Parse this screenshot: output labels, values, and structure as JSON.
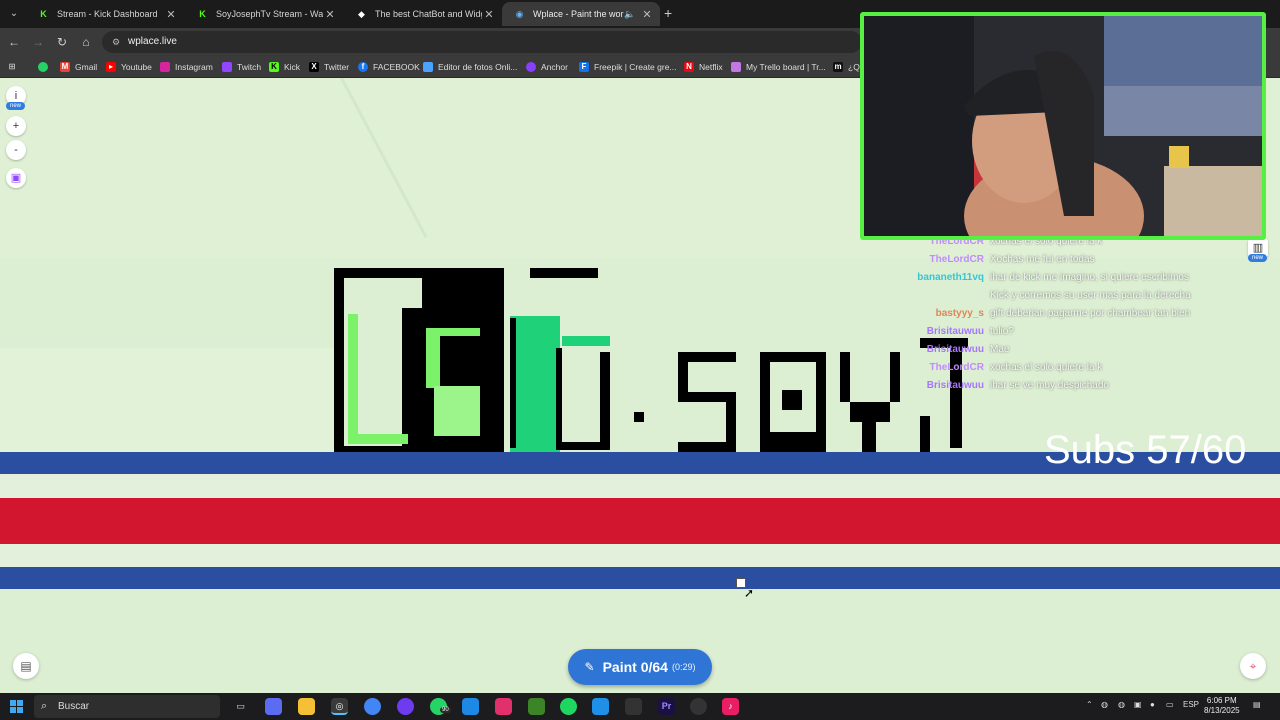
{
  "browser": {
    "tabs": [
      {
        "title": "Stream - Kick Dashboard",
        "icon": "kick-icon",
        "active": false
      },
      {
        "title": "SoyJosephTv Stream - Watch Li",
        "icon": "kick-icon",
        "active": false
      },
      {
        "title": "The best ChatBot and Widgets",
        "icon": "botrix-icon",
        "active": false
      },
      {
        "title": "Wplace - Paint the world",
        "icon": "globe-icon",
        "active": true
      }
    ],
    "url": "wplace.live",
    "bookmarks": [
      "Gmail",
      "Youtube",
      "Instagram",
      "Twitch",
      "Kick",
      "Twitter",
      "FACEBOOK",
      "Editor de fotos Onli...",
      "Anchor",
      "Freepik | Create gre...",
      "Netflix",
      "My Trello board | Tr...",
      "¿Qu"
    ]
  },
  "page": {
    "left_controls": {
      "info": "i",
      "badge": "new",
      "zoom_in": "+",
      "zoom_out": "-"
    },
    "right_badge": "new",
    "pixel_text": "D.SQVJ",
    "subs_text": "Subs 57/60",
    "chat": [
      {
        "user": "TheLordCR",
        "color": "#c18bff",
        "msg": "xochas el solo quiere la k"
      },
      {
        "user": "TheLordCR",
        "color": "#c18bff",
        "msg": "Xochas me fui en todas"
      },
      {
        "user": "bananeth11vq",
        "color": "#36c5d6",
        "msg": "ihar de kick me imagino, si quiere escribimos"
      },
      {
        "user": "",
        "color": "#ffffff",
        "msg": "Kick y corremos su user mas para la derecha"
      },
      {
        "user": "bastyyy_s",
        "color": "#e0865a",
        "msg": "gift deberian pagarme por chambear tan bien"
      },
      {
        "user": "Brisitauwuu",
        "color": "#a775ff",
        "msg": "tulio?"
      },
      {
        "user": "Brisitauwuu",
        "color": "#a775ff",
        "msg": "Mae"
      },
      {
        "user": "TheLordCR",
        "color": "#c18bff",
        "msg": "xochas el solo quiere la k"
      },
      {
        "user": "Brisitauwuu",
        "color": "#a775ff",
        "msg": "ihar se ve muy despichado"
      }
    ],
    "paint": {
      "label": "Paint",
      "count": "0/64",
      "timer": "(0:29)"
    }
  },
  "taskbar": {
    "search_placeholder": "Buscar",
    "whatsapp_badge": "90",
    "lang": "ESP",
    "time": "6:06 PM",
    "date": "8/13/2025"
  },
  "colors": {
    "map_bg": "#dcefd2",
    "flag_blue": "#2b4fa0",
    "flag_red": "#d21630",
    "paint_button": "#2f75d6",
    "cam_border": "#56f042"
  }
}
